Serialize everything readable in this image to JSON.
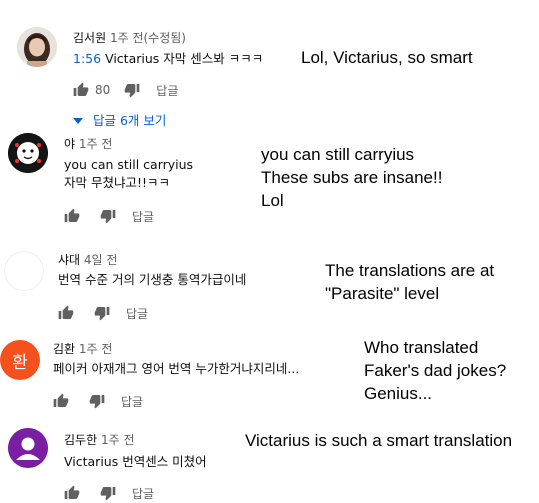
{
  "comments": [
    {
      "author": "김서원",
      "time": "1주 전(수정됨)",
      "timestamp_link": "1:56",
      "text": "Victarius 자막 센스봐 ㅋㅋㅋ",
      "like_count": "80",
      "reply_label": "답글",
      "view_replies_label": "답글 6개 보기",
      "annotation": "Lol, Victarius, so smart"
    },
    {
      "author": "야",
      "time": "1주 전",
      "text_lines": [
        "you can still carryius",
        "자막 무쳤냐고!!ㅋㅋ"
      ],
      "reply_label": "답글",
      "annotation_lines": [
        "you can still carryius",
        "These subs are insane!!",
        "Lol"
      ]
    },
    {
      "author": "샤대",
      "time": "4일 전",
      "text": "번역 수준 거의 기생충 통역가급이네",
      "reply_label": "답글",
      "annotation_lines": [
        "The translations are at",
        "\"Parasite\" level"
      ]
    },
    {
      "author": "김환",
      "time": "1주 전",
      "avatar_letter": "환",
      "text": "페이커 아재개그 영어 번역 누가한거냐지리네...",
      "reply_label": "답글",
      "annotation_lines": [
        "Who translated",
        "Faker's dad jokes?",
        "Genius..."
      ]
    },
    {
      "author": "김두한",
      "time": "1주 전",
      "text": "Victarius 번역센스 미쳤어",
      "reply_label": "답글",
      "annotation": "Victarius is such a smart translation"
    }
  ],
  "colors": {
    "link_blue": "#065fd4",
    "avatar_orange": "#f4511e",
    "avatar_purple": "#7b1fa2",
    "icon_gray": "#606060"
  },
  "icons": [
    "thumb-up-icon",
    "thumb-down-icon",
    "chevron-down-icon",
    "person-icon"
  ]
}
